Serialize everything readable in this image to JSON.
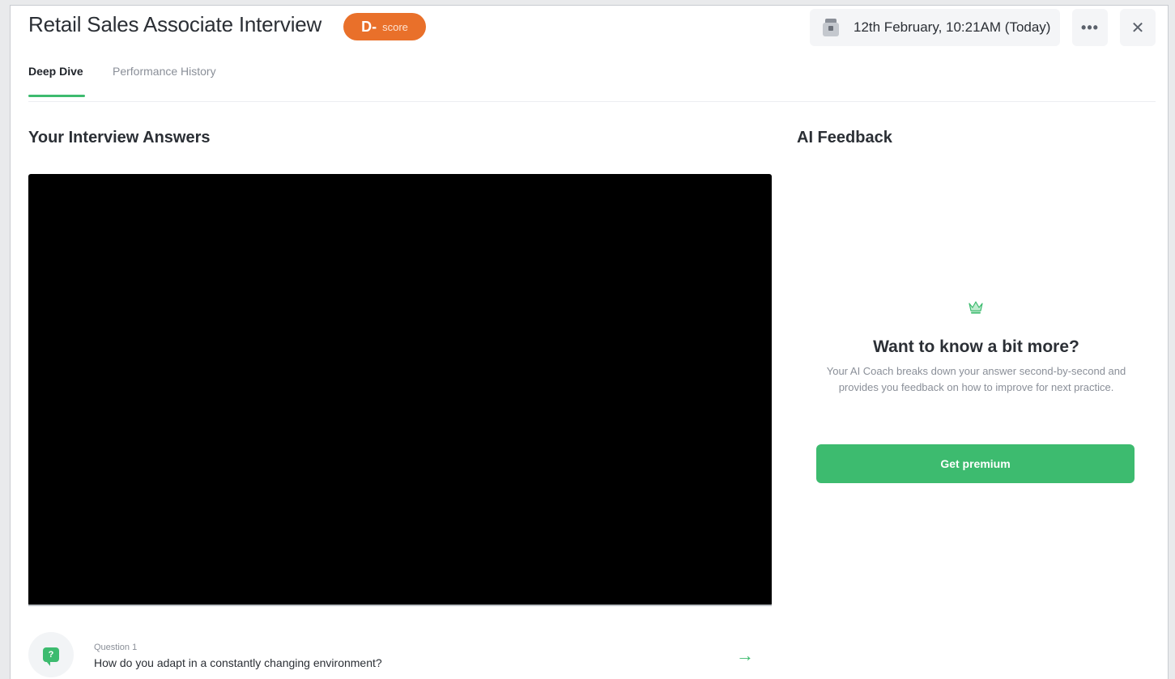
{
  "header": {
    "title": "Retail Sales Associate Interview",
    "score": {
      "grade": "D-",
      "label": "score",
      "color": "#e9702a"
    },
    "date": "12th February, 10:21AM (Today)",
    "more_icon": "more-horizontal-icon",
    "close_icon": "close-icon",
    "calendar_icon": "calendar-icon"
  },
  "tabs": [
    {
      "label": "Deep Dive",
      "active": true
    },
    {
      "label": "Performance History",
      "active": false
    }
  ],
  "answers": {
    "title": "Your Interview Answers",
    "question": {
      "label": "Question 1",
      "text": "How do you adapt in a constantly changing environment?",
      "icon": "question-bubble-icon",
      "arrow_icon": "arrow-right-icon"
    }
  },
  "feedback": {
    "title": "AI Feedback",
    "icon": "crown-icon",
    "heading": "Want to know a bit more?",
    "description": "Your AI Coach breaks down your answer second-by-second and provides you feedback on how to improve for next practice.",
    "button_label": "Get premium",
    "accent_color": "#3dbb6f"
  }
}
